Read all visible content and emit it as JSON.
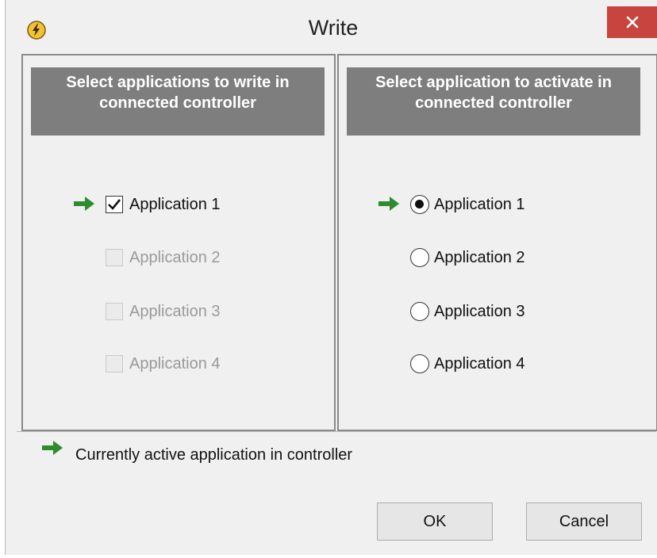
{
  "window": {
    "title": "Write",
    "close_label": "✕",
    "app_icon": "lightning-bolt-icon"
  },
  "write_panel": {
    "header": "Select applications to write in connected controller",
    "items": [
      {
        "label": "Application 1",
        "checked": true,
        "enabled": true,
        "active": true
      },
      {
        "label": "Application 2",
        "checked": false,
        "enabled": false,
        "active": false
      },
      {
        "label": "Application 3",
        "checked": false,
        "enabled": false,
        "active": false
      },
      {
        "label": "Application 4",
        "checked": false,
        "enabled": false,
        "active": false
      }
    ]
  },
  "activate_panel": {
    "header": "Select application to activate in connected controller",
    "items": [
      {
        "label": "Application 1",
        "selected": true,
        "active": true
      },
      {
        "label": "Application 2",
        "selected": false,
        "active": false
      },
      {
        "label": "Application 3",
        "selected": false,
        "active": false
      },
      {
        "label": "Application 4",
        "selected": false,
        "active": false
      }
    ]
  },
  "legend": {
    "text": "Currently active application in controller",
    "icon": "green-arrow-icon"
  },
  "buttons": {
    "ok": "OK",
    "cancel": "Cancel"
  },
  "colors": {
    "close_bg": "#c7443f",
    "header_bg": "#7e7e7e",
    "arrow_green": "#2e8b2e"
  }
}
